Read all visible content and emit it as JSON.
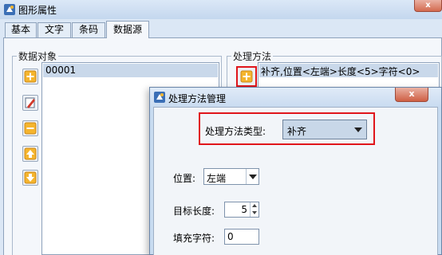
{
  "window": {
    "title": "图形属性",
    "close_label": "x"
  },
  "tabs": [
    {
      "label": "基本"
    },
    {
      "label": "文字"
    },
    {
      "label": "条码"
    },
    {
      "label": "数据源",
      "active": true
    }
  ],
  "data_objects": {
    "label": "数据对象",
    "items": [
      "00001"
    ]
  },
  "processing": {
    "label": "处理方法",
    "items": [
      "补齐,位置<左端>长度<5>字符<0>"
    ]
  },
  "dialog": {
    "title": "处理方法管理",
    "close_label": "x",
    "type_label": "处理方法类型:",
    "type_value": "补齐",
    "position_label": "位置:",
    "position_value": "左端",
    "length_label": "目标长度:",
    "length_value": "5",
    "fill_label": "填充字符:",
    "fill_value": "0"
  },
  "colors": {
    "highlight": "#e0151b",
    "selection": "#c9d8ea",
    "accent_orange": "#f0a020"
  }
}
